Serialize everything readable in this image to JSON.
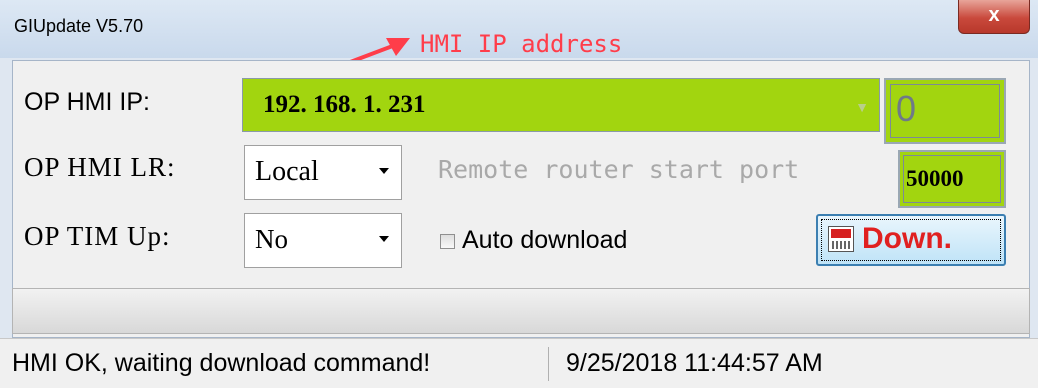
{
  "window": {
    "title": "GIUpdate V5.70",
    "close_glyph": "x"
  },
  "annotation": {
    "text": "HMI IP address",
    "color": "#ff3d4a"
  },
  "form": {
    "ip_label": "OP HMI IP:",
    "ip_value": "192. 168. 1. 231",
    "ip_count": "0",
    "lr_label": "OP HMI LR:",
    "lr_selected": "Local",
    "remote_label": "Remote router start port",
    "port_value": "50000",
    "tim_label": "OP TIM Up:",
    "tim_selected": "No",
    "auto_download_label": "Auto download",
    "auto_download_checked": false,
    "download_button_label": "Down.",
    "download_icon": "download-icon"
  },
  "progress": {
    "percent": 0
  },
  "status": {
    "message": "HMI OK, waiting download command!",
    "timestamp": "9/25/2018  11:44:57 AM"
  },
  "colors": {
    "field_green": "#a2d50f",
    "button_text_red": "#e02020"
  }
}
